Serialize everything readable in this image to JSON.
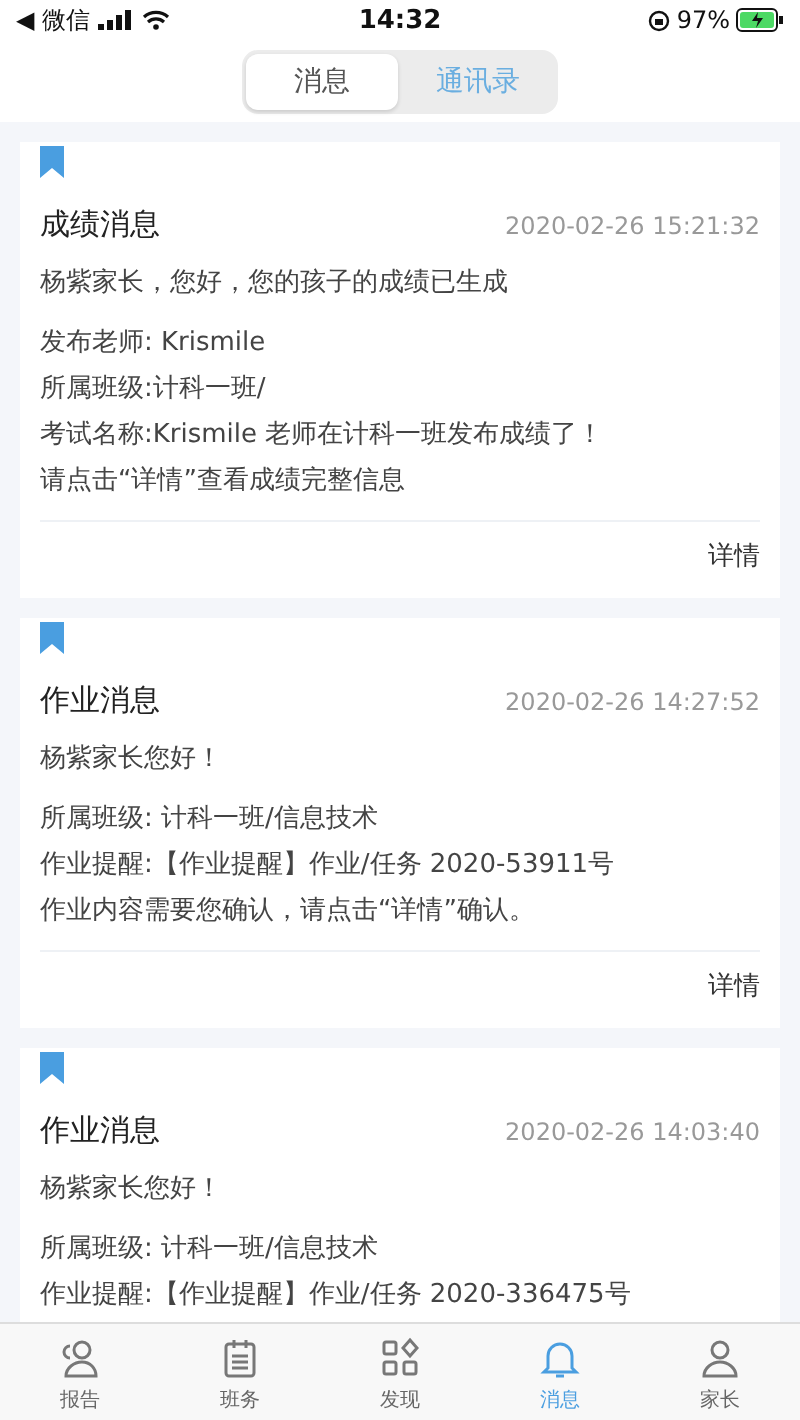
{
  "status_bar": {
    "back_label": "◀ 微信",
    "time": "14:32",
    "battery": "97%"
  },
  "segments": [
    {
      "label": "消息",
      "selected": true
    },
    {
      "label": "通讯录",
      "selected": false
    }
  ],
  "messages": [
    {
      "title": "成绩消息",
      "time": "2020-02-26 15:21:32",
      "greeting": "杨紫家长，您好，您的孩子的成绩已生成",
      "lines": [
        "发布老师: Krismile",
        "所属班级:计科一班/",
        "考试名称:Krismile 老师在计科一班发布成绩了！",
        "请点击“详情”查看成绩完整信息"
      ],
      "action": "详情"
    },
    {
      "title": "作业消息",
      "time": "2020-02-26 14:27:52",
      "greeting": "杨紫家长您好！",
      "lines": [
        "所属班级: 计科一班/信息技术",
        "作业提醒:【作业提醒】作业/任务 2020-53911号",
        "作业内容需要您确认，请点击“详情”确认。"
      ],
      "action": "详情"
    },
    {
      "title": "作业消息",
      "time": "2020-02-26 14:03:40",
      "greeting": "杨紫家长您好！",
      "lines": [
        "所属班级: 计科一班/信息技术",
        "作业提醒:【作业提醒】作业/任务 2020-336475号"
      ]
    }
  ],
  "tab_bar": [
    {
      "label": "报告",
      "kind": "report",
      "selected": false
    },
    {
      "label": "班务",
      "kind": "calendar",
      "selected": false
    },
    {
      "label": "发现",
      "kind": "discover",
      "selected": false
    },
    {
      "label": "消息",
      "kind": "bell",
      "selected": true
    },
    {
      "label": "家长",
      "kind": "person",
      "selected": false
    }
  ]
}
